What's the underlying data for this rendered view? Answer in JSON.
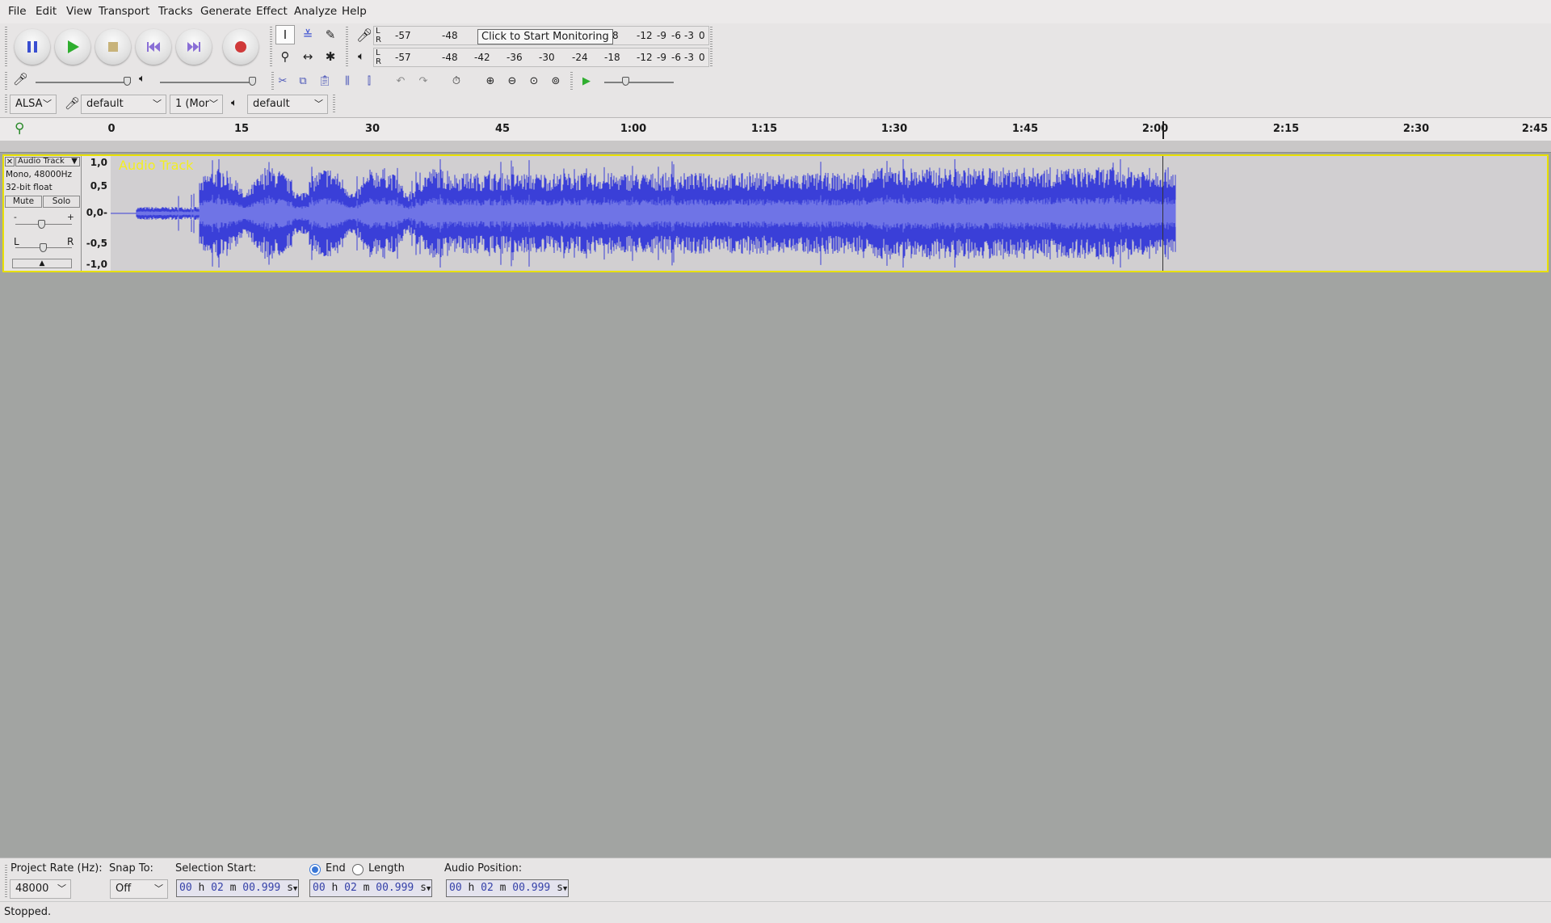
{
  "menu": [
    "File",
    "Edit",
    "View",
    "Transport",
    "Tracks",
    "Generate",
    "Effect",
    "Analyze",
    "Help"
  ],
  "transport": {
    "pause": "pause-icon",
    "play": "play-icon",
    "stop": "stop-icon",
    "skip_start": "skip-start-icon",
    "skip_end": "skip-end-icon",
    "record": "record-icon"
  },
  "meters": {
    "record_ticks": [
      "-57",
      "-48",
      "-12",
      "-9",
      "-6",
      "-3",
      "0"
    ],
    "monitor_label": "Click to Start Monitoring",
    "monitor_tail": "8",
    "playback_ticks": [
      "-57",
      "-48",
      "-42",
      "-36",
      "-30",
      "-24",
      "-18",
      "-12",
      "-9",
      "-6",
      "-3",
      "0"
    ],
    "lr": [
      "L",
      "R"
    ]
  },
  "devices": {
    "host": "ALSA",
    "recording_device": "default",
    "channels": "1 (Mor",
    "playback_device": "default"
  },
  "ruler": {
    "ticks": [
      "0",
      "15",
      "30",
      "45",
      "1:00",
      "1:15",
      "1:30",
      "1:45",
      "2:00",
      "2:15",
      "2:30",
      "2:45"
    ]
  },
  "track": {
    "name": "Audio Track",
    "info_line1": "Mono, 48000Hz",
    "info_line2": "32-bit float",
    "mute": "Mute",
    "solo": "Solo",
    "gain_minus": "-",
    "gain_plus": "+",
    "pan_left": "L",
    "pan_right": "R",
    "scale": [
      "1,0",
      "0,5",
      "0,0-",
      "-0,5",
      "-1,0"
    ],
    "wave_color": "#3a3fd8",
    "wave_fill_color": "#6f74e6"
  },
  "selection": {
    "project_rate_label": "Project Rate (Hz):",
    "project_rate": "48000",
    "snap_label": "Snap To:",
    "snap": "Off",
    "sel_start_label": "Selection Start:",
    "end_label": "End",
    "length_label": "Length",
    "audio_pos_label": "Audio Position:",
    "sel_start_digits": [
      "00",
      "02",
      "00.999"
    ],
    "end_digits": [
      "00",
      "02",
      "00.999"
    ],
    "audio_pos_digits": [
      "00",
      "02",
      "00.999"
    ],
    "units": [
      "h",
      "m",
      "s"
    ]
  },
  "status": "Stopped."
}
